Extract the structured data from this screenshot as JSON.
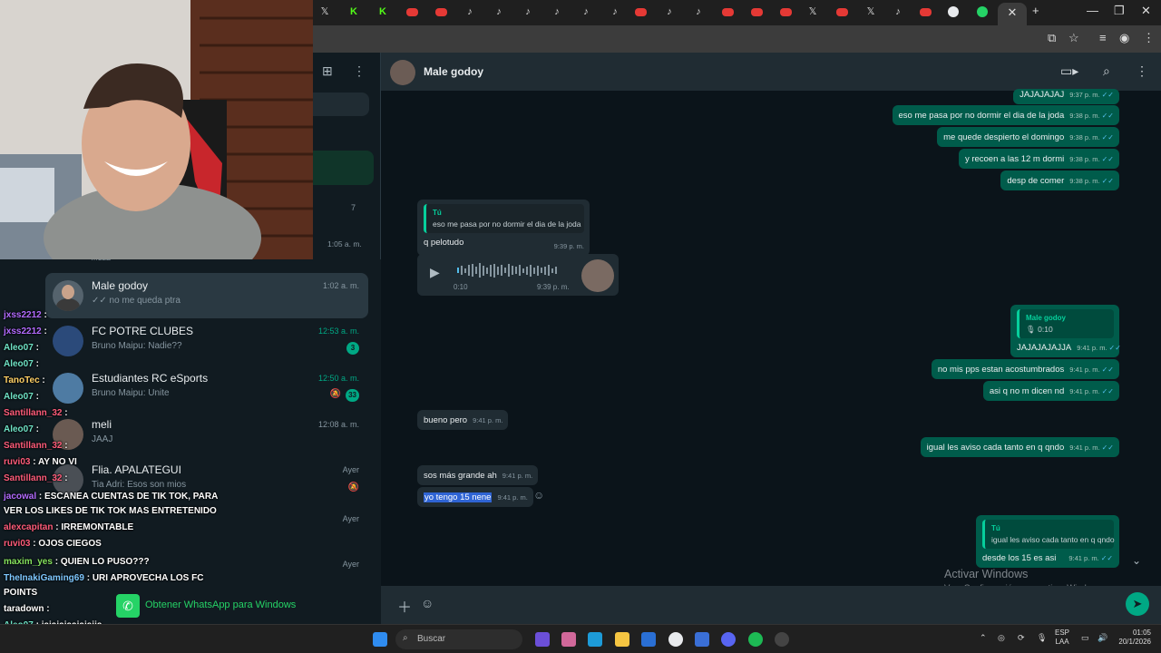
{
  "browser": {
    "close_tab": "✕",
    "new_tab": "+",
    "window_controls": [
      "—",
      "❐",
      "✕"
    ]
  },
  "sidebar": {
    "banner_snippet": "ar",
    "banner_close": "✕",
    "unread_count": "7",
    "first_time": "1:05 a. m.",
    "first_name_snippet": "…LLE",
    "chats": [
      {
        "name": "Male godoy",
        "preview": "no me queda ptra",
        "time": "1:02 a. m.",
        "ticks": "✓✓"
      },
      {
        "name": "FC POTRE CLUBES",
        "preview": "Bruno Maipu: Nadie??",
        "time": "12:53 a. m.",
        "badge": "3"
      },
      {
        "name": "Estudiantes RC eSports",
        "preview": "Bruno Maipu: Unite",
        "time": "12:50 a. m.",
        "badge": "33"
      },
      {
        "name": "meli",
        "preview": "JAAJ",
        "time": "12:08 a. m."
      },
      {
        "name": "Flia. APALATEGUI",
        "preview": "Tia Adri: Esos son  mios",
        "time": "Ayer"
      },
      {
        "name": "",
        "preview": "",
        "time": "Ayer"
      },
      {
        "name": "",
        "preview": "",
        "time": "Ayer"
      }
    ]
  },
  "chat": {
    "contact_name": "Male godoy",
    "messages_out_top": [
      {
        "text": "JAJAJAJAJ",
        "time": "9:37 p. m."
      },
      {
        "text": "eso me pasa por no dormir el dia de la joda",
        "time": "9:38 p. m."
      },
      {
        "text": "me quede despierto el domingo",
        "time": "9:38 p. m."
      },
      {
        "text": "y recoen a las 12 m dormi",
        "time": "9:38 p. m."
      },
      {
        "text": "desp de comer",
        "time": "9:38 p. m."
      }
    ],
    "reply_in": {
      "quote_name": "Tú",
      "quote_text": "eso me pasa por no dormir el dia de la joda",
      "text": "q pelotudo",
      "time": "9:39 p. m."
    },
    "voice_in": {
      "duration": "0:10",
      "time": "9:39 p. m."
    },
    "reply_out": {
      "quote_name": "Male godoy",
      "quote_text": "0:10",
      "text": "JAJAJAJAJJA",
      "time": "9:41 p. m."
    },
    "messages_out_mid": [
      {
        "text": "no mis pps estan acostumbrados",
        "time": "9:41 p. m."
      },
      {
        "text": "asi q no m dicen nd",
        "time": "9:41 p. m."
      }
    ],
    "in_1": {
      "text": "bueno pero",
      "time": "9:41 p. m."
    },
    "out_1": {
      "text": "igual les aviso cada tanto en q qndo",
      "time": "9:41 p. m."
    },
    "in_2": {
      "text": "sos más grande ah",
      "time": "9:41 p. m."
    },
    "in_3": {
      "text": "yo tengo 15 nene",
      "time": "9:41 p. m."
    },
    "reply_out_2": {
      "quote_name": "Tú",
      "quote_text": "igual les aviso cada tanto en q qndo",
      "text": "desde los 15 es asi",
      "time": "9:41 p. m."
    },
    "activate_title": "Activar Windows",
    "activate_sub": "Ve a Configuración para activar Windows."
  },
  "stream_chat": [
    {
      "user": "jxss2212",
      "color": "#b36bff",
      "msg": ""
    },
    {
      "user": "jxss2212",
      "color": "#b36bff",
      "msg": ""
    },
    {
      "user": "Aleo07",
      "color": "#6fe3c6",
      "msg": ""
    },
    {
      "user": "Aleo07",
      "color": "#6fe3c6",
      "msg": ""
    },
    {
      "user": "TanoTec",
      "color": "#ffd166",
      "msg": ""
    },
    {
      "user": "Aleo07",
      "color": "#6fe3c6",
      "msg": ""
    },
    {
      "user": "Santillann_32",
      "color": "#ff5c7a",
      "msg": ""
    },
    {
      "user": "Aleo07",
      "color": "#6fe3c6",
      "msg": ""
    },
    {
      "user": "Santillann_32",
      "color": "#ff5c7a",
      "msg": ""
    },
    {
      "user": "ruvi03",
      "color": "#ff5c7a",
      "msg": "AY NO VI"
    },
    {
      "user": "Santillann_32",
      "color": "#ff5c7a",
      "msg": ""
    },
    {
      "user": "jacowal",
      "color": "#b36bff",
      "msg": "ESCANEA CUENTAS DE TIK TOK, PARA"
    },
    {
      "user": "",
      "color": "#ffffff",
      "msg": "VER LOS LIKES DE TIK TOK MAS ENTRETENIDO"
    },
    {
      "user": "alexcapitan",
      "color": "#ff5c7a",
      "msg": "IRREMONTABLE"
    },
    {
      "user": "ruvi03",
      "color": "#ff5c7a",
      "msg": "OJOS CIEGOS"
    },
    {
      "user": "maxim_yes",
      "color": "#86e35f",
      "msg": "QUIEN LO PUSO???"
    },
    {
      "user": "TheInakiGaming69",
      "color": "#7ec8ff",
      "msg": "URI APROVECHA LOS FC"
    },
    {
      "user": "",
      "color": "#ffffff",
      "msg": "POINTS"
    },
    {
      "user": "taradown",
      "color": "#ffffff",
      "msg": ""
    },
    {
      "user": "Aleo07",
      "color": "#6fe3c6",
      "msg": "jajajajaajajajja"
    },
    {
      "user": "taradown",
      "color": "#ffffff",
      "msg": ""
    }
  ],
  "get_whatsapp": "Obtener WhatsApp para Windows",
  "taskbar": {
    "search_label": "Buscar",
    "lang_1": "ESP",
    "lang_2": "LAA",
    "time": "01:05",
    "date": "20/1/2026"
  },
  "colors": {
    "accent": "#00a884",
    "outgoing": "#005c4b",
    "incoming": "#202c33",
    "background": "#0b141a"
  }
}
